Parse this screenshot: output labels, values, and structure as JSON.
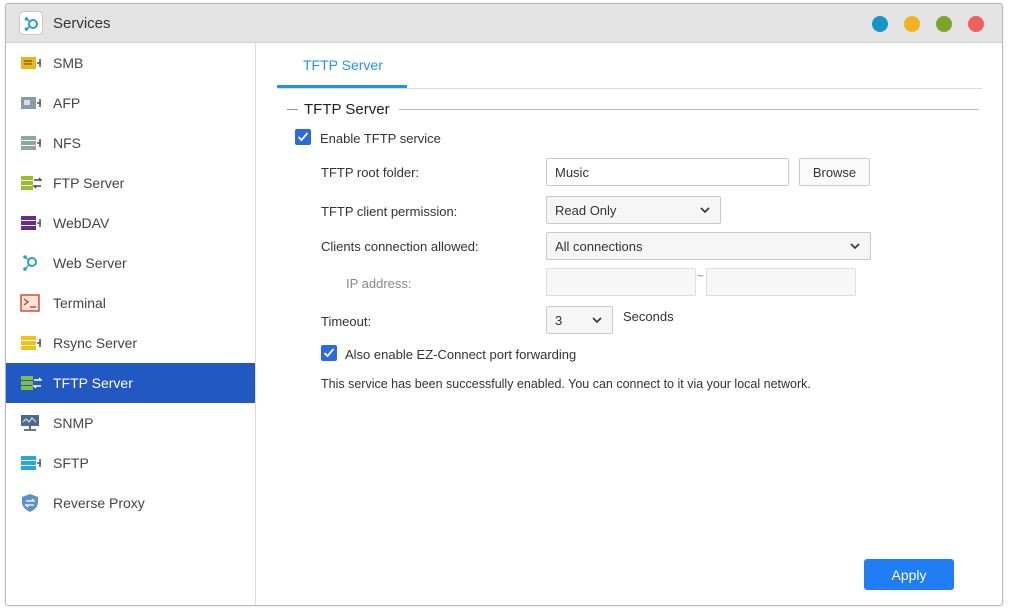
{
  "window": {
    "title": "Services",
    "controls": [
      {
        "name": "window-btn-blue",
        "color": "#1397c7"
      },
      {
        "name": "window-btn-yellow",
        "color": "#f4b223"
      },
      {
        "name": "window-btn-green",
        "color": "#7ba62a"
      },
      {
        "name": "window-btn-red",
        "color": "#f0605f"
      }
    ]
  },
  "sidebar": {
    "items": [
      {
        "label": "SMB",
        "icon": "smb-icon"
      },
      {
        "label": "AFP",
        "icon": "afp-icon"
      },
      {
        "label": "NFS",
        "icon": "nfs-icon"
      },
      {
        "label": "FTP Server",
        "icon": "ftp-server-icon"
      },
      {
        "label": "WebDAV",
        "icon": "webdav-icon"
      },
      {
        "label": "Web Server",
        "icon": "web-server-icon"
      },
      {
        "label": "Terminal",
        "icon": "terminal-icon"
      },
      {
        "label": "Rsync Server",
        "icon": "rsync-server-icon"
      },
      {
        "label": "TFTP Server",
        "icon": "tftp-server-icon",
        "active": true
      },
      {
        "label": "SNMP",
        "icon": "snmp-icon"
      },
      {
        "label": "SFTP",
        "icon": "sftp-icon"
      },
      {
        "label": "Reverse Proxy",
        "icon": "reverse-proxy-icon"
      }
    ]
  },
  "main": {
    "tab_label": "TFTP Server",
    "section_title": "TFTP Server",
    "enable_label": "Enable TFTP service",
    "enable_checked": true,
    "root_folder_label": "TFTP root folder:",
    "root_folder_value": "Music",
    "browse_label": "Browse",
    "permission_label": "TFTP client permission:",
    "permission_value": "Read Only",
    "connections_label": "Clients connection allowed:",
    "connections_value": "All connections",
    "ip_label": "IP address:",
    "ip_separator": "~",
    "timeout_label": "Timeout:",
    "timeout_value": "3",
    "timeout_unit": "Seconds",
    "ezconnect_label": "Also enable EZ-Connect port forwarding",
    "ezconnect_checked": true,
    "status_message": "This service has been successfully enabled. You can connect to it via your local network.",
    "apply_label": "Apply"
  },
  "colors": {
    "accent": "#2158c2",
    "tab_accent": "#2196e8",
    "apply_button": "#1f7ef5",
    "checkbox": "#2b6ae0"
  }
}
